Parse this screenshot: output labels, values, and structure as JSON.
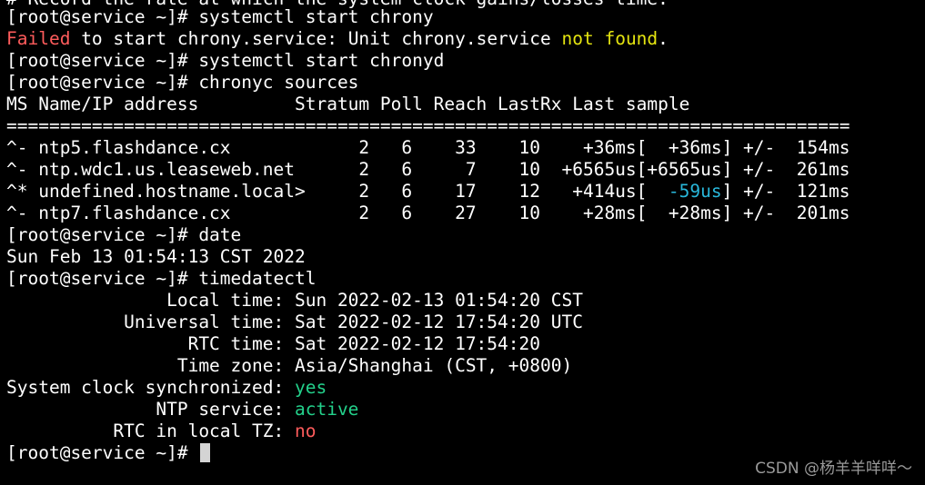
{
  "terminal": {
    "partial_top_line": "# Record the rate at which the system clock gains/losses time.",
    "lines": [
      "[root@service ~]# systemctl start chrony",
      [
        "Failed",
        " to start chrony.service: Unit chrony.service ",
        "not found",
        "."
      ],
      "[root@service ~]# systemctl start chronyd",
      "[root@service ~]# chronyc sources",
      "MS Name/IP address         Stratum Poll Reach LastRx Last sample",
      "===============================================================================",
      "^- ntp5.flashdance.cx            2   6    33    10    +36ms[  +36ms] +/-  154ms",
      "^- ntp.wdc1.us.leaseweb.net      2   6     7    10  +6565us[+6565us] +/-  261ms",
      [
        "^* undefined.hostname.local>     2   6    17    12   +414us[  ",
        "-59us",
        "] +/-  121ms"
      ],
      "^- ntp7.flashdance.cx            2   6    27    10    +28ms[  +28ms] +/-  201ms",
      "[root@service ~]# date",
      "Sun Feb 13 01:54:13 CST 2022",
      "[root@service ~]# timedatectl",
      "               Local time: Sun 2022-02-13 01:54:20 CST",
      "           Universal time: Sat 2022-02-12 17:54:20 UTC",
      "                 RTC time: Sat 2022-02-12 17:54:20",
      "                Time zone: Asia/Shanghai (CST, +0800)",
      [
        "System clock synchronized: ",
        "yes"
      ],
      [
        "              NTP service: ",
        "active"
      ],
      [
        "          RTC in local TZ: ",
        "no"
      ],
      "[root@service ~]# "
    ]
  },
  "colors": {
    "background": "#000000",
    "foreground": "#ffffff",
    "error": "#ff5c5c",
    "warning": "#e5e510",
    "ok": "#23d18b",
    "offset": "#29b8db"
  },
  "watermark": "CSDN @杨羊羊咩咩～"
}
